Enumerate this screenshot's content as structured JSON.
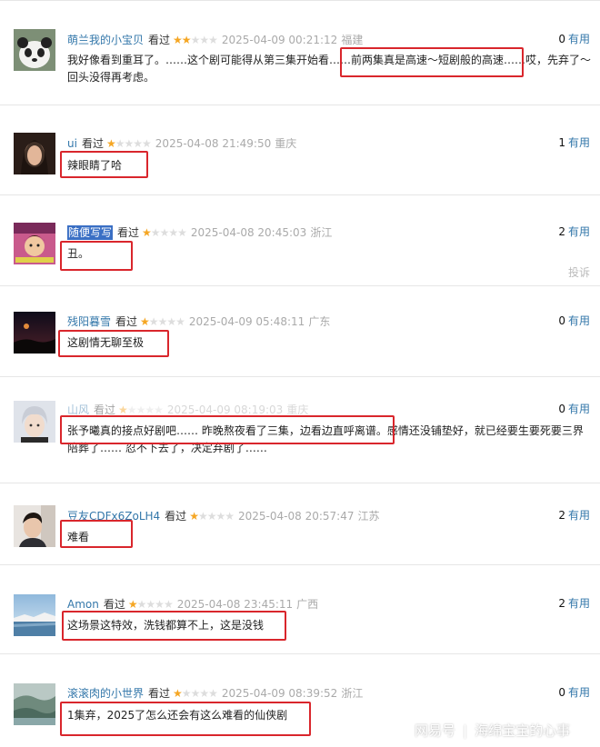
{
  "watched_label": "看过",
  "useful_label": "有用",
  "report_label": "投诉",
  "colors": {
    "username": "#3377aa",
    "star_on": "#f5a623",
    "star_off": "#dddddd",
    "highlight": "#d9262c"
  },
  "comments": [
    {
      "user": "萌兰我的小宝贝",
      "stars": 2,
      "time": "2025-04-09 00:21:12",
      "location": "福建",
      "useful": "0",
      "text": "我好像看到重耳了。……这个剧可能得从第三集开始看……前两集真是高速～短剧般的高速……哎，先弃了～回头没得再考虑。"
    },
    {
      "user": "ui",
      "stars": 1,
      "time": "2025-04-08 21:49:50",
      "location": "重庆",
      "useful": "1",
      "text": "辣眼睛了哈"
    },
    {
      "user": "随便写写",
      "stars": 1,
      "time": "2025-04-08 20:45:03",
      "location": "浙江",
      "useful": "2",
      "text": "丑。"
    },
    {
      "user": "残阳暮雪",
      "stars": 1,
      "time": "2025-04-09 05:48:11",
      "location": "广东",
      "useful": "0",
      "text": "这剧情无聊至极"
    },
    {
      "user": "山风",
      "stars": 1,
      "time": "2025-04-09 08:19:03",
      "location": "重庆",
      "useful": "0",
      "text": "张予曦真的接点好剧吧…… 昨晚熬夜看了三集，边看边直呼离谱。感情还没铺垫好，就已经要生要死要三界陪葬了…… 忍不下去了，决定弃剧了……"
    },
    {
      "user": "豆友CDFx6ZoLH4",
      "stars": 1,
      "time": "2025-04-08 20:57:47",
      "location": "江苏",
      "useful": "2",
      "text": "难看"
    },
    {
      "user": "Amon",
      "stars": 1,
      "time": "2025-04-08 23:45:11",
      "location": "广西",
      "useful": "2",
      "text": "这场景这特效，洗钱都算不上，这是没钱"
    },
    {
      "user": "滚滚肉的小世界",
      "stars": 1,
      "time": "2025-04-09 08:39:52",
      "location": "浙江",
      "useful": "0",
      "text": "1集弃，2025了怎么还会有这么难看的仙侠剧"
    }
  ],
  "watermark": {
    "brand": "网易号",
    "separator": "|",
    "author": "海绵宝宝的心事"
  }
}
